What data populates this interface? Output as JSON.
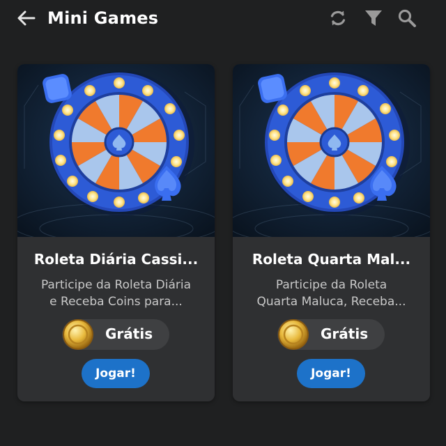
{
  "header": {
    "title": "Mini Games",
    "back_icon": "arrow-left-icon",
    "actions": [
      "refresh-icon",
      "filter-icon",
      "search-icon"
    ]
  },
  "games": [
    {
      "title": "Roleta Diária Cassi...",
      "description_line1": "Participe da Roleta Diária",
      "description_line2": "e Receba Coins para...",
      "price_label": "Grátis",
      "play_label": "Jogar!"
    },
    {
      "title": "Roleta Quarta Mal...",
      "description_line1": "Participe da Roleta",
      "description_line2": "Quarta Maluca, Receba...",
      "price_label": "Grátis",
      "play_label": "Jogar!"
    }
  ],
  "colors": {
    "background": "#1f2021",
    "card": "#2f3032",
    "button": "#1d72c9",
    "wheel_orange": "#f07a2d",
    "wheel_blue": "#2d5bd6",
    "coin": "#e2b437"
  }
}
